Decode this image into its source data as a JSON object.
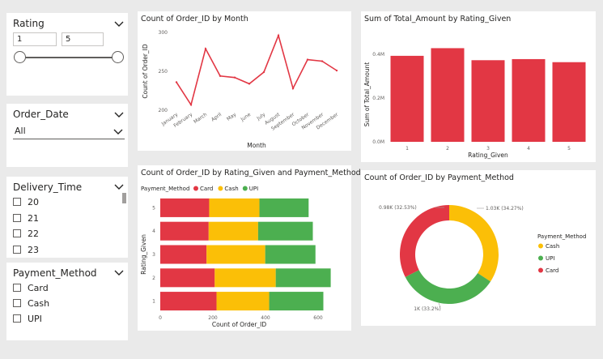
{
  "slicers": {
    "rating": {
      "title": "Rating",
      "min": "1",
      "max": "5"
    },
    "order_date": {
      "title": "Order_Date",
      "selected": "All"
    },
    "delivery_time": {
      "title": "Delivery_Time",
      "items": [
        "20",
        "21",
        "22",
        "23"
      ]
    },
    "payment_method": {
      "title": "Payment_Method",
      "items": [
        "Card",
        "Cash",
        "UPI"
      ]
    }
  },
  "colors": {
    "red": "#e23744",
    "yellow": "#fbbf07",
    "green": "#4caf50",
    "bg": "#eaeaea"
  },
  "visuals": {
    "month_line": {
      "title": "Count of Order_ID by Month"
    },
    "rating_bar": {
      "title": "Sum of Total_Amount by Rating_Given"
    },
    "stacked_bar": {
      "title": "Count of Order_ID by Rating_Given and Payment_Method"
    },
    "donut": {
      "title": "Count of Order_ID by Payment_Method"
    }
  },
  "chart_data": [
    {
      "type": "line",
      "title": "Count of Order_ID by Month",
      "xlabel": "Month",
      "ylabel": "Count of Order_ID",
      "categories": [
        "January",
        "February",
        "March",
        "April",
        "May",
        "June",
        "July",
        "August",
        "September",
        "October",
        "November",
        "December"
      ],
      "values": [
        236,
        207,
        279,
        244,
        242,
        234,
        249,
        296,
        228,
        265,
        263,
        251
      ],
      "yticks": [
        "200",
        "250",
        "300"
      ],
      "ylim": [
        200,
        300
      ]
    },
    {
      "type": "bar",
      "title": "Sum of Total_Amount by Rating_Given",
      "xlabel": "Rating_Given",
      "ylabel": "Sum of Total_Amount",
      "categories": [
        "1",
        "2",
        "3",
        "4",
        "5"
      ],
      "values": [
        0.393,
        0.428,
        0.373,
        0.378,
        0.364
      ],
      "yticks": [
        "0.0M",
        "0.2M",
        "0.4M"
      ],
      "ylim": [
        0,
        0.4
      ]
    },
    {
      "type": "bar",
      "orientation": "horizontal",
      "stacked": true,
      "title": "Count of Order_ID by Rating_Given and Payment_Method",
      "xlabel": "Count of Order_ID",
      "ylabel": "Rating_Given",
      "legend_title": "Payment_Method",
      "categories": [
        "5",
        "4",
        "3",
        "2",
        "1"
      ],
      "series": [
        {
          "name": "Card",
          "color": "#e23744",
          "values": [
            186,
            184,
            176,
            207,
            214
          ]
        },
        {
          "name": "Cash",
          "color": "#fbbf07",
          "values": [
            191,
            188,
            223,
            232,
            200
          ]
        },
        {
          "name": "UPI",
          "color": "#4caf50",
          "values": [
            187,
            208,
            191,
            209,
            206
          ]
        }
      ],
      "xticks": [
        "0",
        "200",
        "400",
        "600"
      ],
      "xlim": [
        0,
        650
      ]
    },
    {
      "type": "pie",
      "donut": true,
      "title": "Count of Order_ID by Payment_Method",
      "legend_title": "Payment_Method",
      "labels": [
        "Cash",
        "UPI",
        "Card"
      ],
      "values": [
        1.03,
        1.0,
        0.98
      ],
      "colors": [
        "#fbbf07",
        "#4caf50",
        "#e23744"
      ],
      "data_labels": [
        "1.03K (34.27%)",
        "1K (33.2%)",
        "0.98K (32.53%)"
      ]
    }
  ]
}
